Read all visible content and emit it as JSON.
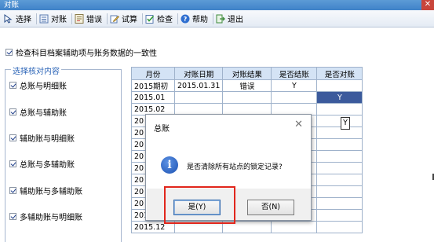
{
  "window": {
    "title": "对账",
    "close_symbol": "✕"
  },
  "toolbar": {
    "items": [
      {
        "label": "选择",
        "icon": "select-icon"
      },
      {
        "label": "对账",
        "icon": "reconcile-icon"
      },
      {
        "label": "错误",
        "icon": "error-icon"
      },
      {
        "label": "试算",
        "icon": "trial-balance-icon"
      },
      {
        "label": "检查",
        "icon": "check-icon"
      },
      {
        "label": "帮助",
        "icon": "help-icon"
      },
      {
        "label": "退出",
        "icon": "exit-icon"
      }
    ]
  },
  "options": {
    "consistency_label": "检查科目档案辅助项与账务数据的一致性",
    "group_title": "选择核对内容",
    "items": [
      {
        "label": "总账与明细账",
        "checked": true
      },
      {
        "label": "总账与辅助账",
        "checked": true
      },
      {
        "label": "辅助账与明细账",
        "checked": true
      },
      {
        "label": "总账与多辅助账",
        "checked": true
      },
      {
        "label": "辅助账与多辅助账",
        "checked": true
      },
      {
        "label": "多辅助账与明细账",
        "checked": true
      }
    ]
  },
  "grid": {
    "columns": [
      "月份",
      "对账日期",
      "对账结果",
      "是否结账",
      "是否对账"
    ],
    "rows": [
      [
        "2015期初",
        "2015.01.31",
        "错误",
        "Y",
        ""
      ],
      [
        "2015.01",
        "",
        "",
        "",
        "Y"
      ],
      [
        "2015.02",
        "",
        "",
        "",
        ""
      ],
      [
        "20",
        "",
        "",
        "",
        "Y"
      ],
      [
        "20",
        "",
        "",
        "",
        ""
      ],
      [
        "20",
        "",
        "",
        "",
        ""
      ],
      [
        "20",
        "",
        "",
        "",
        ""
      ],
      [
        "20",
        "",
        "",
        "",
        ""
      ],
      [
        "20",
        "",
        "",
        "",
        ""
      ],
      [
        "20",
        "",
        "",
        "",
        ""
      ],
      [
        "20",
        "",
        "",
        "",
        ""
      ],
      [
        "2015.11",
        "",
        "",
        "",
        ""
      ],
      [
        "2015.12",
        "",
        "",
        "",
        ""
      ]
    ],
    "selected_row": 1,
    "selected_col": 4
  },
  "dialog": {
    "title": "总账",
    "close_symbol": "✕",
    "icon": "info-icon",
    "icon_glyph": "i",
    "message": "是否清除所有站点的锁定记录?",
    "yes_label": "是(Y)",
    "no_label": "否(N)"
  },
  "colors": {
    "title_bar": "#3f82c8",
    "header": "#d4e3f5",
    "selection": "#3b5a9c",
    "highlight": "#e1261c",
    "group_title": "#2b64b7"
  }
}
